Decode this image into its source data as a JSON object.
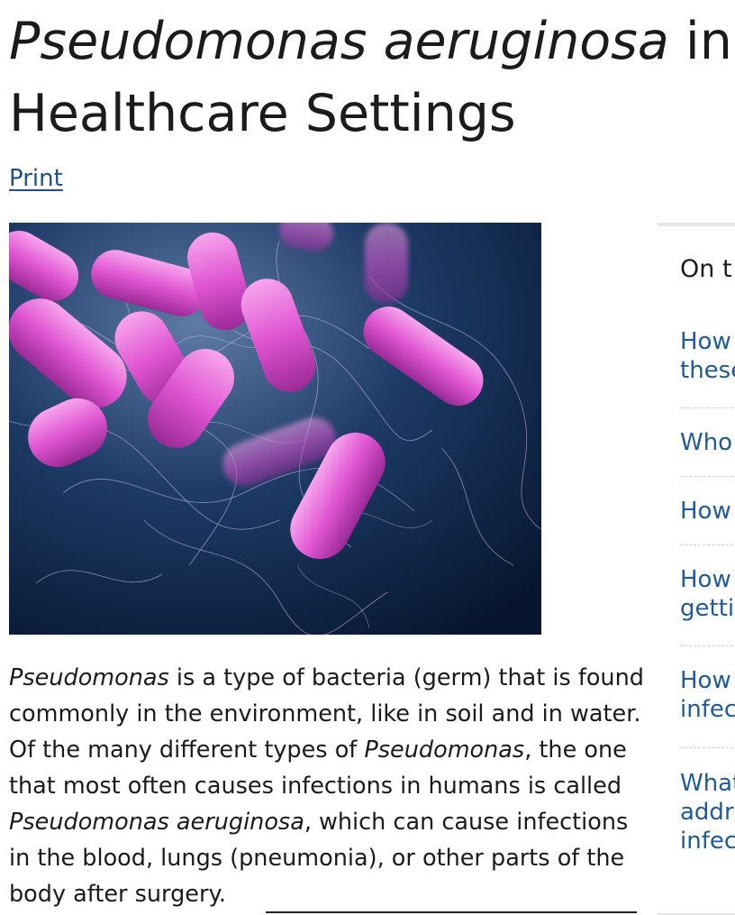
{
  "header": {
    "title_italic": "Pseudomonas aeruginosa",
    "title_rest_line1": " in",
    "title_line2": "Healthcare Settings"
  },
  "actions": {
    "print_label": "Print"
  },
  "hero_image": {
    "subject": "illustration of rod-shaped bacteria with flagella"
  },
  "intro": {
    "p1_italic": "Pseudomonas",
    "p1_text1": " is a type of bacteria (germ) that is found commonly in the environment, like in soil and in water. Of the many different types of ",
    "p1_italic2": "Pseudomonas",
    "p1_text2": ", the one that most often causes infections in humans is called ",
    "p1_italic3": "Pseudomonas aeruginosa",
    "p1_text3": ", which can cause infections in the blood, lungs (pneumonia), or other parts of the body after surgery."
  },
  "sidebar": {
    "heading": "On t",
    "items": [
      {
        "line1": "How",
        "line2": "these"
      },
      {
        "line1": "Who",
        "line2": ""
      },
      {
        "line1": "How",
        "line2": ""
      },
      {
        "line1": "How",
        "line2": "gettin"
      },
      {
        "line1": "How",
        "line2": "infec"
      },
      {
        "line1": "What",
        "line2": "addr",
        "line3": "infec"
      }
    ]
  },
  "colors": {
    "link": "#1f4f8b",
    "sidebar_link": "#1f5a99",
    "text": "#1b1b1b",
    "bacteria": "#e25ad4",
    "image_bg": "#0d2240"
  }
}
